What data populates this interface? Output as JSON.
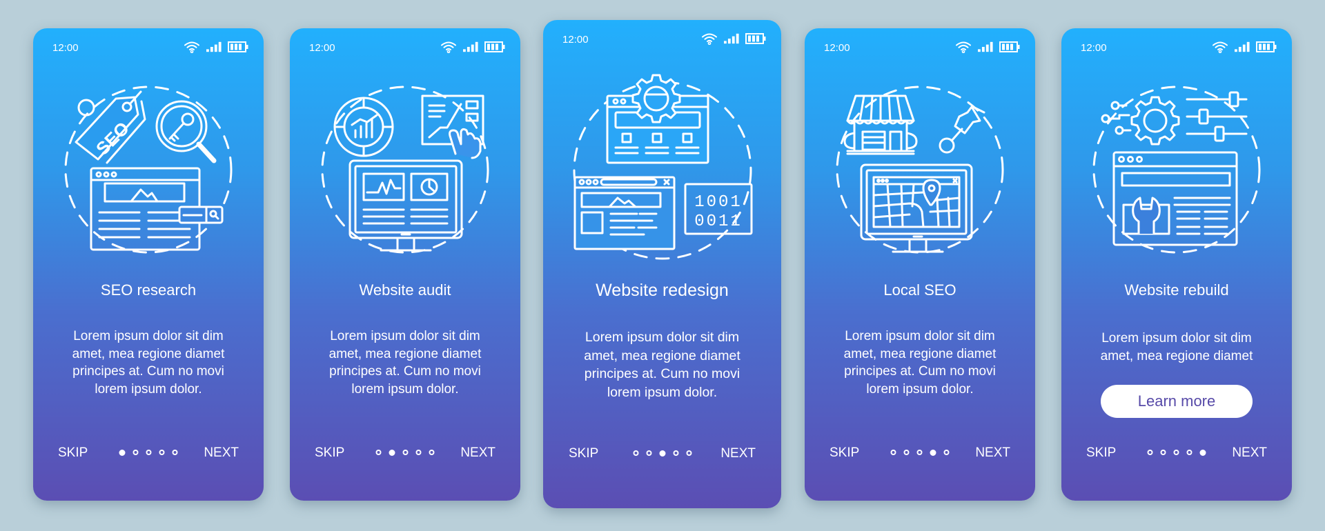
{
  "status_bar": {
    "time": "12:00",
    "icons": [
      "wifi-icon",
      "signal-icon",
      "battery-icon"
    ]
  },
  "colors": {
    "background": "#b9cfd9",
    "gradient_top": "#22b0fd",
    "gradient_bottom": "#5b4eb3",
    "button_text": "#574aa8",
    "foreground": "#ffffff"
  },
  "nav": {
    "skip_label": "SKIP",
    "next_label": "NEXT",
    "total_steps": 5
  },
  "cards": [
    {
      "title": "SEO research",
      "illustration": "seo-research-illustration",
      "body_lines": [
        "Lorem ipsum dolor sit dim",
        "amet, mea regione diamet",
        "principes at. Cum no movi",
        "lorem ipsum dolor."
      ],
      "active_step": 1
    },
    {
      "title": "Website audit",
      "illustration": "website-audit-illustration",
      "body_lines": [
        "Lorem ipsum dolor sit dim",
        "amet, mea regione diamet",
        "principes at. Cum no movi",
        "lorem ipsum dolor."
      ],
      "active_step": 2
    },
    {
      "title": "Website redesign",
      "illustration": "website-redesign-illustration",
      "body_lines": [
        "Lorem ipsum dolor sit dim",
        "amet, mea regione diamet",
        "principes at. Cum no movi",
        "lorem ipsum dolor."
      ],
      "active_step": 3,
      "binary_lines": [
        "1001",
        "0011"
      ]
    },
    {
      "title": "Local SEO",
      "illustration": "local-seo-illustration",
      "body_lines": [
        "Lorem ipsum dolor sit dim",
        "amet, mea regione diamet",
        "principes at. Cum no movi",
        "lorem ipsum dolor."
      ],
      "active_step": 4
    },
    {
      "title": "Website rebuild",
      "illustration": "website-rebuild-illustration",
      "body_lines": [
        "Lorem ipsum dolor sit dim",
        "amet, mea regione diamet"
      ],
      "active_step": 5,
      "button_label": "Learn more"
    }
  ]
}
